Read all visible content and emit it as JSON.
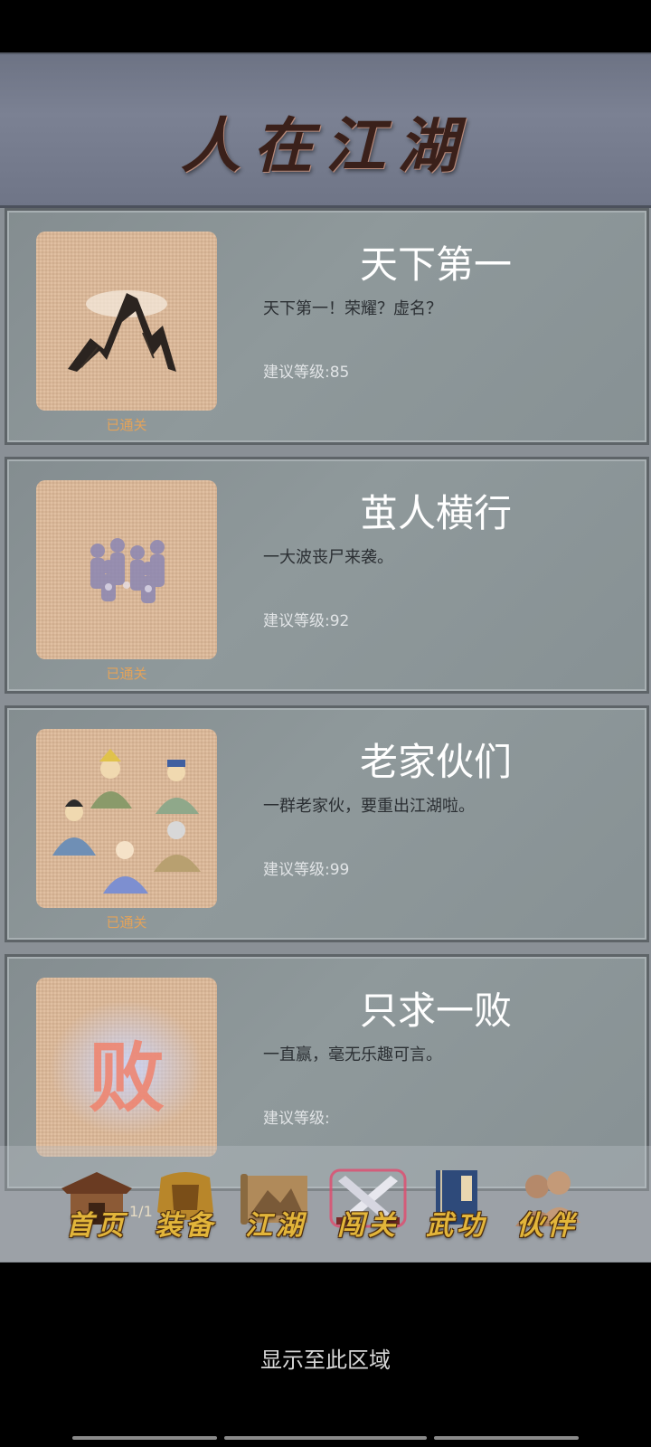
{
  "header": {
    "title": "人在江湖"
  },
  "stages": [
    {
      "name": "天下第一",
      "description": "天下第一！荣耀？虚名？",
      "level": "建议等级:85",
      "status": "已通关",
      "icon": "mountain-icon"
    },
    {
      "name": "茧人横行",
      "description": "一大波丧尸来袭。",
      "level": "建议等级:92",
      "status": "已通关",
      "icon": "zombies-icon"
    },
    {
      "name": "老家伙们",
      "description": "一群老家伙，要重出江湖啦。",
      "level": "建议等级:99",
      "status": "已通关",
      "icon": "elders-icon"
    },
    {
      "name": "只求一败",
      "description": "一直赢，毫无乐趣可言。",
      "level": "建议等级:",
      "status": "",
      "icon": "defeat-glyph-icon",
      "glyph": "败"
    }
  ],
  "pager": {
    "text": "1/1"
  },
  "nav": {
    "items": [
      {
        "label": "首页",
        "icon": "house-icon"
      },
      {
        "label": "装备",
        "icon": "armor-icon"
      },
      {
        "label": "江湖",
        "icon": "map-scroll-icon"
      },
      {
        "label": "闯关",
        "icon": "crossed-swords-icon",
        "active": true
      },
      {
        "label": "武功",
        "icon": "book-icon"
      },
      {
        "label": "伙伴",
        "icon": "companions-icon"
      }
    ]
  },
  "footer": {
    "hint": "显示至此区域"
  },
  "colors": {
    "cleared": "#e4a35a",
    "nav_label": "#e2b53a",
    "title": "#3a201a"
  }
}
